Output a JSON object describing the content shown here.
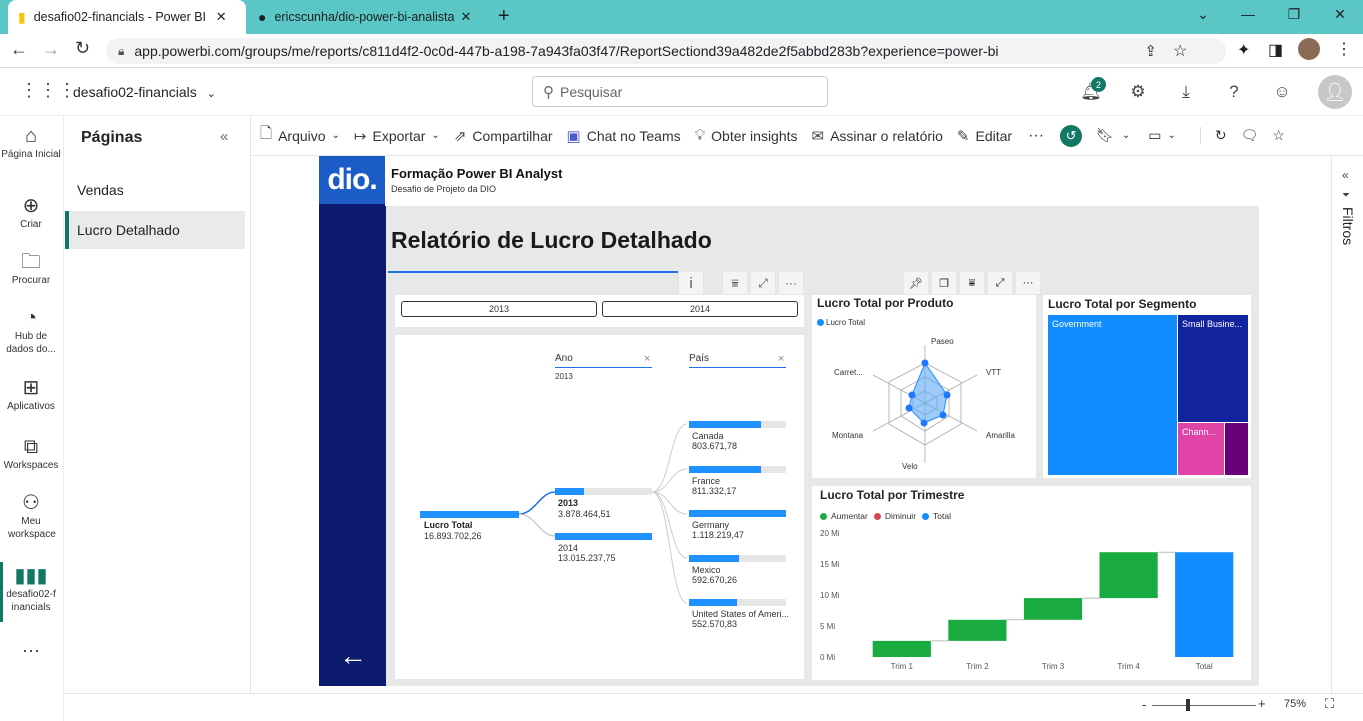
{
  "browser": {
    "tabs": [
      {
        "title": "desafio02-financials - Power BI"
      },
      {
        "title": "ericscunha/dio-power-bi-analista"
      }
    ],
    "url": "app.powerbi.com/groups/me/reports/c811d4f2-0c0d-447b-a198-7a943fa03f47/ReportSectiond39a482de2f5abbd283b?experience=power-bi"
  },
  "header": {
    "workspace": "desafio02-financials",
    "search_placeholder": "Pesquisar",
    "notifications_count": "2"
  },
  "leftnav": {
    "items": [
      {
        "label": "Página Inicial"
      },
      {
        "label": "Criar"
      },
      {
        "label": "Procurar"
      },
      {
        "label": "Hub de dados do..."
      },
      {
        "label": "Aplicativos"
      },
      {
        "label": "Workspaces"
      },
      {
        "label": "Meu workspace"
      },
      {
        "label": "desafio02-financials"
      }
    ]
  },
  "pages": {
    "title": "Páginas",
    "items": [
      "Vendas",
      "Lucro Detalhado"
    ]
  },
  "toolbar": {
    "arquivo": "Arquivo",
    "exportar": "Exportar",
    "compartilhar": "Compartilhar",
    "teams": "Chat no Teams",
    "insights": "Obter insights",
    "assinar": "Assinar o relatório",
    "editar": "Editar"
  },
  "report": {
    "brand": "dio.",
    "header_title": "Formação Power BI Analyst",
    "header_subtitle": "Desafio de Projeto da DIO",
    "page_title": "Relatório de Lucro Detalhado",
    "slicer": [
      "2013",
      "2014"
    ],
    "decomp": {
      "ano_label": "Ano",
      "ano_value": "2013",
      "pais_label": "País",
      "root_label": "Lucro Total",
      "root_value": "16.893.702,26",
      "years": [
        {
          "label": "2013",
          "value": "3.878.464,51"
        },
        {
          "label": "2014",
          "value": "13.015.237,75"
        }
      ],
      "countries": [
        {
          "label": "Canada",
          "value": "803.671,78",
          "pct": 0.74
        },
        {
          "label": "France",
          "value": "811.332,17",
          "pct": 0.74
        },
        {
          "label": "Germany",
          "value": "1.118.219,47",
          "pct": 1.0
        },
        {
          "label": "Mexico",
          "value": "592.670,26",
          "pct": 0.52
        },
        {
          "label": "United States of Ameri...",
          "value": "552.570,83",
          "pct": 0.49
        }
      ]
    },
    "radar": {
      "title": "Lucro Total por Produto",
      "legend": "Lucro Total",
      "labels": [
        "Paseo",
        "VTT",
        "Amarilla",
        "Velo",
        "Montana",
        "Carret..."
      ]
    },
    "treemap": {
      "title": "Lucro Total por Segmento",
      "tiles": [
        "Government",
        "Small Busine...",
        "Chann..."
      ]
    },
    "waterfall": {
      "title": "Lucro Total por Trimestre",
      "legend": [
        "Aumentar",
        "Diminuir",
        "Total"
      ],
      "yticks": [
        "20 Mi",
        "15 Mi",
        "10 Mi",
        "5 Mi",
        "0 Mi"
      ],
      "categories": [
        "Trim 1",
        "Trim 2",
        "Trim 3",
        "Trim 4",
        "Total"
      ]
    }
  },
  "chart_data": {
    "type": "bar",
    "title": "Lucro Total por Trimestre",
    "categories": [
      "Trim 1",
      "Trim 2",
      "Trim 3",
      "Trim 4",
      "Total"
    ],
    "series": [
      {
        "name": "Aumentar",
        "values": [
          2.6,
          3.4,
          3.5,
          7.4,
          null
        ]
      },
      {
        "name": "Total",
        "values": [
          null,
          null,
          null,
          null,
          16.9
        ]
      }
    ],
    "ylim": [
      0,
      20
    ],
    "colors": {
      "Aumentar": "#1aab40",
      "Diminuir": "#d64554",
      "Total": "#118dff"
    }
  },
  "statusbar": {
    "zoom": "75%"
  }
}
